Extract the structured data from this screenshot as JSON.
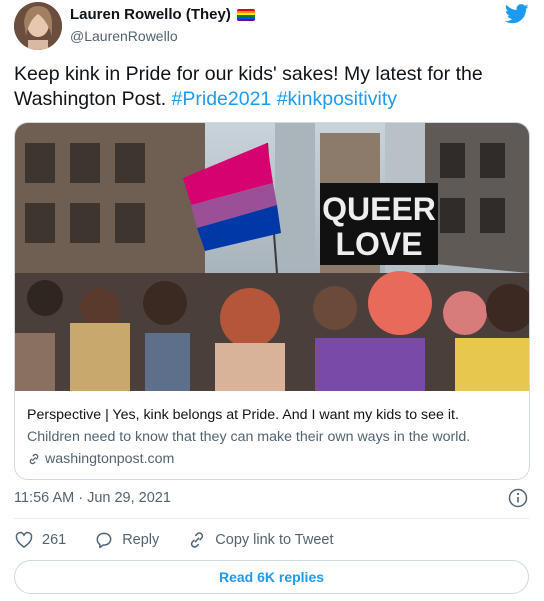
{
  "author": {
    "display_name": "Lauren Rowello (They)",
    "handle": "@LaurenRowello",
    "avatar_icon": "avatar-photo",
    "badge_icon": "rainbow-flag-icon"
  },
  "tweet": {
    "text": "Keep kink in Pride for our kids' sakes! My latest for the Washington Post.",
    "hashtags": [
      "#Pride2021",
      "#kinkpositivity"
    ]
  },
  "card": {
    "image_sign_line1": "QUEER",
    "image_sign_line2": "LOVE",
    "title": "Perspective | Yes, kink belongs at Pride. And I want my kids to see it.",
    "description": "Children need to know that they can make their own ways in the world.",
    "domain": "washingtonpost.com",
    "domain_icon": "link-icon"
  },
  "meta": {
    "timestamp": "11:56 AM · Jun 29, 2021",
    "info_icon": "info-icon"
  },
  "actions": {
    "like_count": "261",
    "reply_label": "Reply",
    "copy_link_label": "Copy link to Tweet"
  },
  "replies_button": {
    "label": "Read 6K replies"
  },
  "colors": {
    "accent": "#1d9bf0",
    "text": "#0f1419",
    "muted": "#536471",
    "border": "#cfd9de"
  }
}
